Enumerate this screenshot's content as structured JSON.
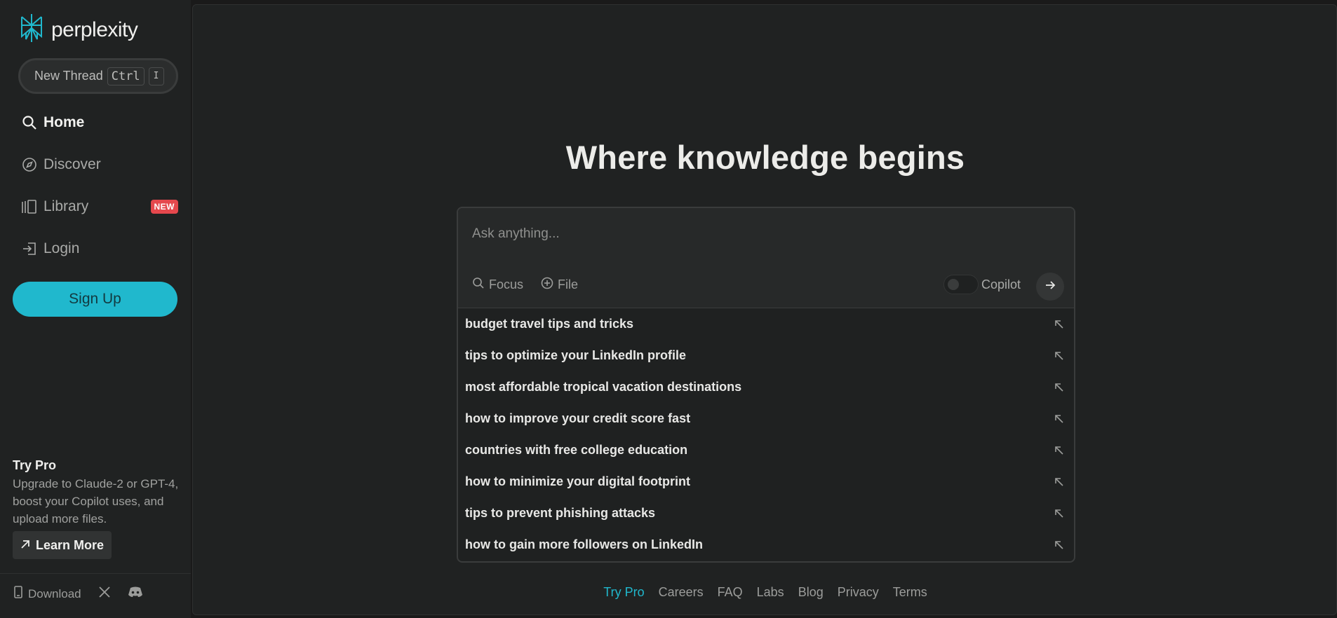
{
  "brand": {
    "name": "perplexity",
    "accent_color": "#20b8cd"
  },
  "sidebar": {
    "new_thread": {
      "label": "New Thread",
      "shortcut_key1": "Ctrl",
      "shortcut_key2": "I"
    },
    "nav": {
      "home": {
        "label": "Home",
        "icon": "search-icon",
        "active": true
      },
      "discover": {
        "label": "Discover",
        "icon": "compass-icon"
      },
      "library": {
        "label": "Library",
        "icon": "library-icon",
        "badge": "NEW"
      },
      "login": {
        "label": "Login",
        "icon": "login-icon"
      }
    },
    "signup_label": "Sign Up",
    "try_pro": {
      "title": "Try Pro",
      "description": "Upgrade to Claude-2 or GPT-4, boost your Copilot uses, and upload more files.",
      "learn_more_label": "Learn More"
    },
    "footer": {
      "download_label": "Download"
    }
  },
  "main": {
    "headline": "Where knowledge begins",
    "search": {
      "placeholder": "Ask anything...",
      "focus_label": "Focus",
      "file_label": "File",
      "copilot_label": "Copilot",
      "copilot_enabled": false
    },
    "suggestions": [
      "budget travel tips and tricks",
      "tips to optimize your LinkedIn profile",
      "most affordable tropical vacation destinations",
      "how to improve your credit score fast",
      "countries with free college education",
      "how to minimize your digital footprint",
      "tips to prevent phishing attacks",
      "how to gain more followers on LinkedIn"
    ],
    "footer_links": [
      "Try Pro",
      "Careers",
      "FAQ",
      "Labs",
      "Blog",
      "Privacy",
      "Terms"
    ]
  }
}
